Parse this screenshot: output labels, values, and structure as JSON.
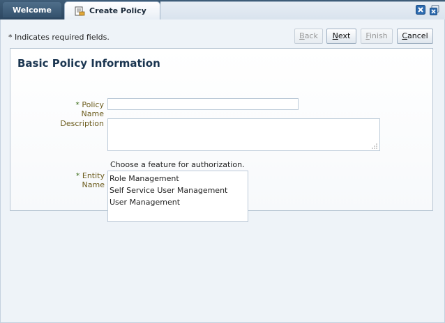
{
  "tabs": {
    "welcome_label": "Welcome",
    "active_label": "Create Policy"
  },
  "window_buttons": {
    "close_icon": "close-x-icon",
    "restore_icon": "close-all-icon"
  },
  "toolbar": {
    "required_note": "* Indicates required fields.",
    "back_label": "Back",
    "back_enabled": false,
    "next_label": "Next",
    "finish_label": "Finish",
    "finish_enabled": false,
    "cancel_label": "Cancel"
  },
  "form": {
    "section_title": "Basic Policy Information",
    "policy_name": {
      "required_marker": "*",
      "label": "Policy Name",
      "value": ""
    },
    "description": {
      "label": "Description",
      "value": ""
    },
    "entity_hint": "Choose a feature for authorization.",
    "entity_name": {
      "required_marker": "*",
      "label": "Entity Name",
      "options": [
        "Role Management",
        "Self Service User Management",
        "User Management"
      ]
    }
  },
  "colors": {
    "tab_bar": "#2c4761",
    "label_text": "#6b5b1c",
    "required_star": "#3a6d1a",
    "title_text": "#1a3550"
  }
}
